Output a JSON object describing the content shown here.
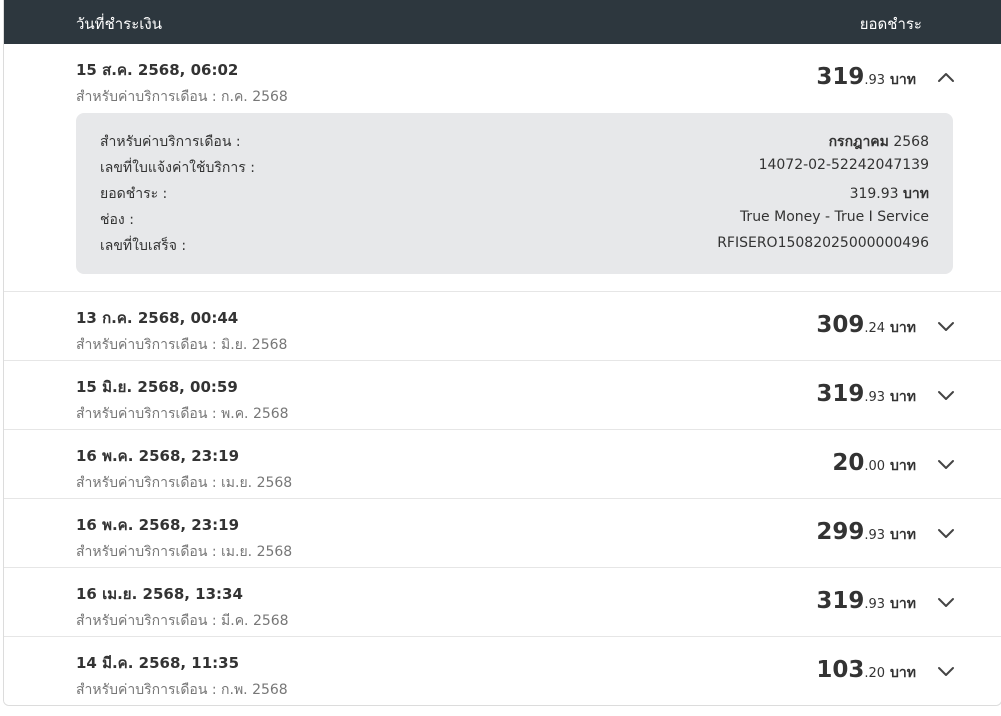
{
  "header": {
    "date_col": "วันที่ชำระเงิน",
    "amount_col": "ยอดชำระ"
  },
  "labels": {
    "service_prefix": "สำหรับค่าบริการเดือน",
    "separator": ":"
  },
  "rows": [
    {
      "date": "15 ส.ค. 2568, 06:02",
      "month": "ก.ค. 2568",
      "amount_int": "319",
      "amount_dec": ".93",
      "unit": "บาท",
      "expanded": true,
      "chevron": "chevron-up-icon"
    },
    {
      "date": "13 ก.ค. 2568, 00:44",
      "month": "มิ.ย. 2568",
      "amount_int": "309",
      "amount_dec": ".24",
      "unit": "บาท",
      "expanded": false,
      "chevron": "chevron-down-icon"
    },
    {
      "date": "15 มิ.ย. 2568, 00:59",
      "month": "พ.ค. 2568",
      "amount_int": "319",
      "amount_dec": ".93",
      "unit": "บาท",
      "expanded": false,
      "chevron": "chevron-down-icon"
    },
    {
      "date": "16 พ.ค. 2568, 23:19",
      "month": "เม.ย. 2568",
      "amount_int": "20",
      "amount_dec": ".00",
      "unit": "บาท",
      "expanded": false,
      "chevron": "chevron-down-icon"
    },
    {
      "date": "16 พ.ค. 2568, 23:19",
      "month": "เม.ย. 2568",
      "amount_int": "299",
      "amount_dec": ".93",
      "unit": "บาท",
      "expanded": false,
      "chevron": "chevron-down-icon"
    },
    {
      "date": "16 เม.ย. 2568, 13:34",
      "month": "มี.ค. 2568",
      "amount_int": "319",
      "amount_dec": ".93",
      "unit": "บาท",
      "expanded": false,
      "chevron": "chevron-down-icon"
    },
    {
      "date": "14 มี.ค. 2568, 11:35",
      "month": "ก.พ. 2568",
      "amount_int": "103",
      "amount_dec": ".20",
      "unit": "บาท",
      "expanded": false,
      "chevron": "chevron-down-icon"
    }
  ],
  "details": {
    "service_month_label": "สำหรับค่าบริการเดือน :",
    "service_month_name": "กรกฎาคม",
    "service_month_year": "2568",
    "invoice_label": "เลขที่ใบแจ้งค่าใช้บริการ :",
    "invoice_value": "14072-02-52242047139",
    "paid_label": "ยอดชำระ :",
    "paid_value": "319.93",
    "paid_unit": "บาท",
    "channel_label": "ช่อง :",
    "channel_value": "True Money - True I Service",
    "receipt_label": "เลขที่ใบเสร็จ :",
    "receipt_value": "RFISERO15082025000000496"
  },
  "colors": {
    "header_bg": "#2d373e",
    "details_bg": "#e7e8ea",
    "divider": "#e6e6e6"
  }
}
